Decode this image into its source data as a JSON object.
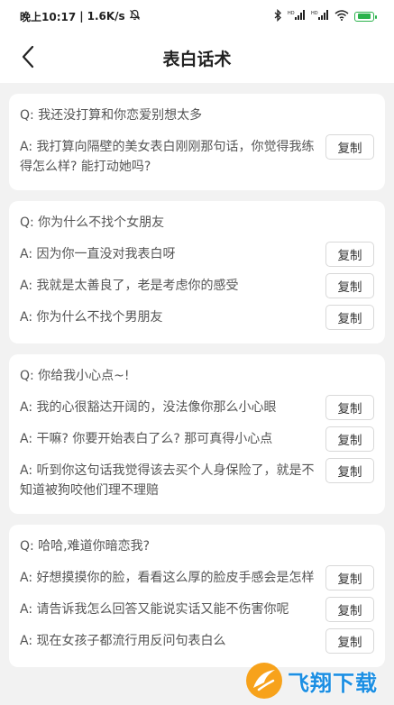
{
  "status_bar": {
    "time": "晚上10:17",
    "speed": "1.6K/s",
    "separator": "|"
  },
  "nav": {
    "title": "表白话术"
  },
  "cards": [
    {
      "question": "Q: 我还没打算和你恋爱别想太多",
      "answers": [
        {
          "text": "A: 我打算向隔壁的美女表白刚刚那句话，你觉得我练得怎么样? 能打动她吗?",
          "copy_label": "复制"
        }
      ]
    },
    {
      "question": "Q: 你为什么不找个女朋友",
      "answers": [
        {
          "text": "A: 因为你一直没对我表白呀",
          "copy_label": "复制"
        },
        {
          "text": "A: 我就是太善良了，老是考虑你的感受",
          "copy_label": "复制"
        },
        {
          "text": "A: 你为什么不找个男朋友",
          "copy_label": "复制"
        }
      ]
    },
    {
      "question": "Q: 你给我小心点~!",
      "answers": [
        {
          "text": "A: 我的心很豁达开阔的，没法像你那么小心眼",
          "copy_label": "复制"
        },
        {
          "text": "A: 干嘛? 你要开始表白了么? 那可真得小心点",
          "copy_label": "复制"
        },
        {
          "text": "A: 听到你这句话我觉得该去买个人身保险了，就是不知道被狗咬他们理不理赔",
          "copy_label": "复制"
        }
      ]
    },
    {
      "question": "Q: 哈哈,难道你暗恋我?",
      "answers": [
        {
          "text": "A: 好想摸摸你的脸，看看这么厚的脸皮手感会是怎样",
          "copy_label": "复制"
        },
        {
          "text": "A: 请告诉我怎么回答又能说实话又能不伤害你呢",
          "copy_label": "复制"
        },
        {
          "text": "A: 现在女孩子都流行用反问句表白么",
          "copy_label": "复制"
        }
      ]
    }
  ],
  "watermark": {
    "text": "飞翔下载"
  },
  "colors": {
    "background": "#f2f2f2",
    "card": "#ffffff",
    "battery": "#2bb24c",
    "watermark": "#1c8fe3"
  }
}
